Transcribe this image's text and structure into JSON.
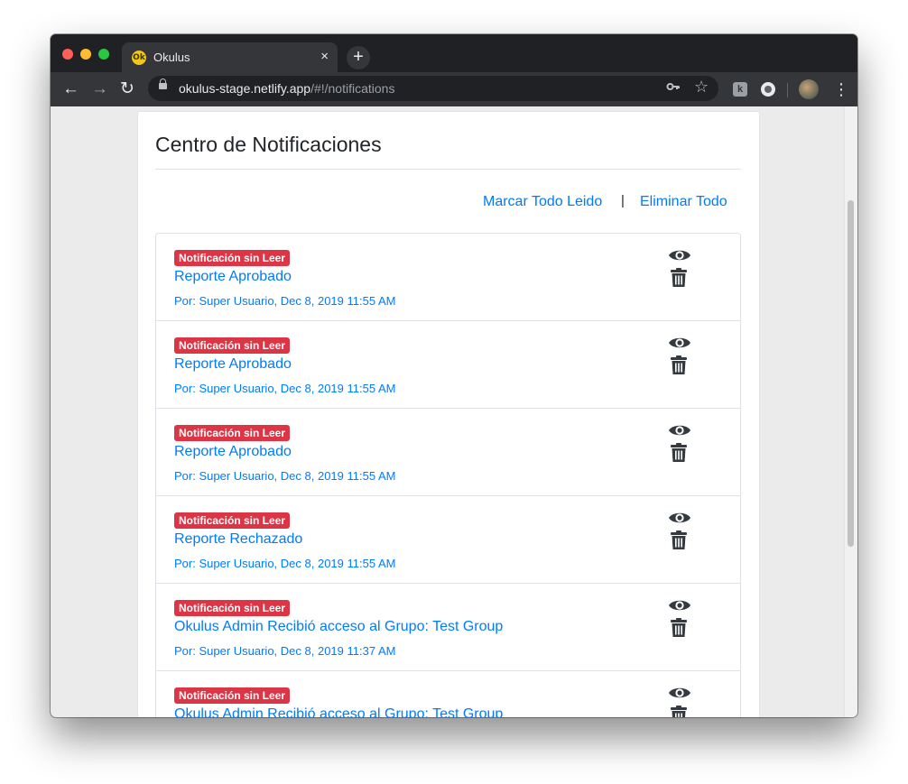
{
  "browser": {
    "tab_title": "Okulus",
    "favicon_text": "Ok",
    "tab_close": "×",
    "new_tab": "+",
    "url_host": "okulus-stage.netlify.app",
    "url_path": "/#!/notifications",
    "ext_letter": "k"
  },
  "page": {
    "title": "Centro de Notificaciones",
    "mark_all_read": "Marcar Todo Leido",
    "separator": "|",
    "delete_all": "Eliminar Todo"
  },
  "notifications": [
    {
      "badge": "Notificación sin Leer",
      "title": "Reporte Aprobado",
      "meta": "Por: Super Usuario, Dec 8, 2019 11:55 AM"
    },
    {
      "badge": "Notificación sin Leer",
      "title": "Reporte Aprobado",
      "meta": "Por: Super Usuario, Dec 8, 2019 11:55 AM"
    },
    {
      "badge": "Notificación sin Leer",
      "title": "Reporte Aprobado",
      "meta": "Por: Super Usuario, Dec 8, 2019 11:55 AM"
    },
    {
      "badge": "Notificación sin Leer",
      "title": "Reporte Rechazado",
      "meta": "Por: Super Usuario, Dec 8, 2019 11:55 AM"
    },
    {
      "badge": "Notificación sin Leer",
      "title": "Okulus Admin Recibió acceso al Grupo: Test Group",
      "meta": "Por: Super Usuario, Dec 8, 2019 11:37 AM"
    },
    {
      "badge": "Notificación sin Leer",
      "title": "Okulus Admin Recibió acceso al Grupo: Test Group",
      "meta": ""
    }
  ],
  "colors": {
    "link": "#007bff",
    "badge": "#dc3545",
    "icon": "#343a40"
  }
}
